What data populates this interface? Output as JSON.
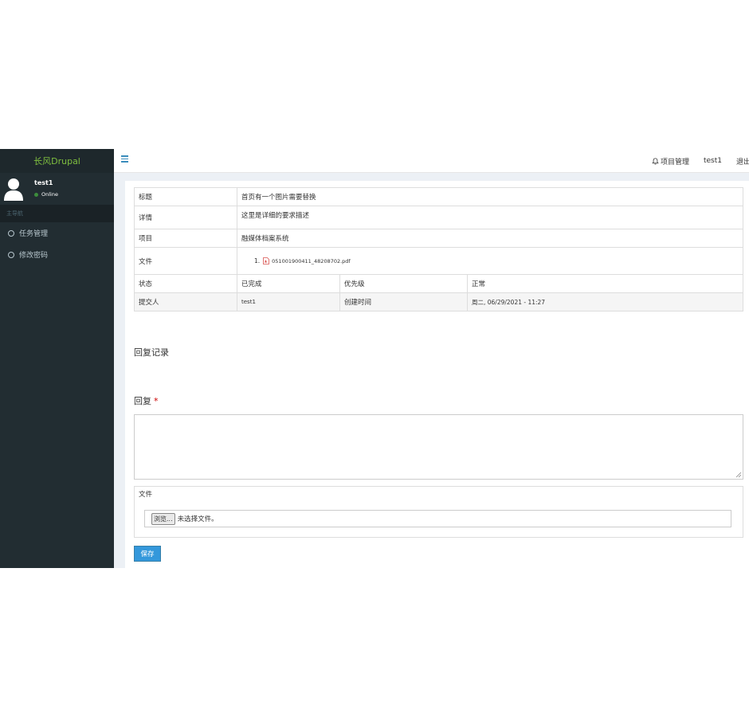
{
  "sidebar": {
    "logo": "长风Drupal",
    "user": {
      "name": "test1",
      "status": "Online"
    },
    "nav_header": "主导航",
    "items": [
      {
        "label": "任务管理"
      },
      {
        "label": "修改密码"
      }
    ]
  },
  "header": {
    "links": [
      {
        "label": "项目管理",
        "icon": "bell-icon"
      },
      {
        "label": "test1"
      },
      {
        "label": "退出"
      }
    ]
  },
  "task": {
    "title_label": "标题",
    "title_value": "首页有一个图片需要替换",
    "detail_label": "详情",
    "detail_value": "这里是详细的要求描述",
    "project_label": "项目",
    "project_value": "融媒体档案系统",
    "file_label": "文件",
    "file_number": "1.",
    "file_name": "051001900411_48208702.pdf",
    "status_label": "状态",
    "status_value": "已完成",
    "priority_label": "优先级",
    "priority_value": "正常",
    "submitter_label": "提交人",
    "submitter_value": "test1",
    "created_label": "创建时间",
    "created_value": "周二, 06/29/2021 - 11:27"
  },
  "reply_history_title": "回复记录",
  "reply_form": {
    "label": "回复",
    "required_marker": "*",
    "textarea_value": "",
    "file_legend": "文件",
    "browse_label": "浏览...",
    "no_file_text": "未选择文件。",
    "save_label": "保存"
  },
  "colors": {
    "sidebar_bg": "#222d32",
    "logo_text": "#7fbf3f",
    "accent": "#3498db",
    "required": "#cc0000"
  }
}
